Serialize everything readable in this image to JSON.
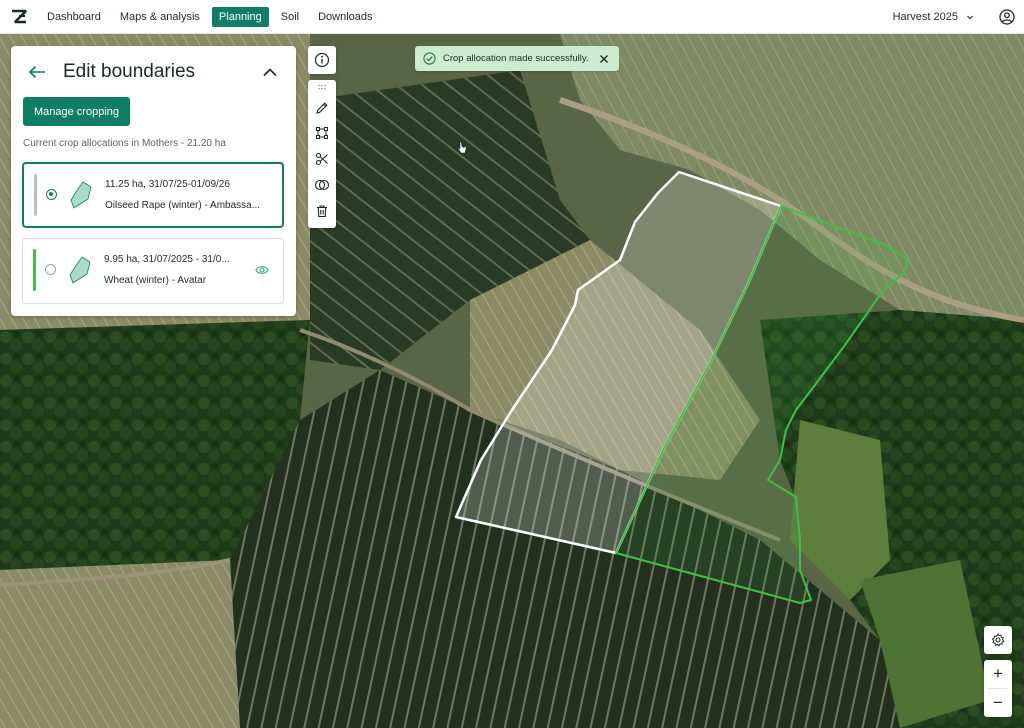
{
  "nav": {
    "items": [
      {
        "label": "Dashboard",
        "active": false
      },
      {
        "label": "Maps & analysis",
        "active": false
      },
      {
        "label": "Planning",
        "active": true
      },
      {
        "label": "Soil",
        "active": false
      },
      {
        "label": "Downloads",
        "active": false
      }
    ],
    "season": "Harvest 2025"
  },
  "panel": {
    "title": "Edit boundaries",
    "manage_button": "Manage cropping",
    "allocation_caption": "Current crop allocations in Mothers - 21.20 ha",
    "crops": [
      {
        "line1": "11.25 ha,  31/07/25-01/09/26",
        "line2": "Oilseed Rape (winter) - Ambassa...",
        "selected": true,
        "bar_color": "#b9bfbc"
      },
      {
        "line1": "9.95 ha,  31/07/2025 - 31/0...",
        "line2": "Wheat (winter) - Avatar",
        "selected": false,
        "bar_color": "#3fbf4a"
      }
    ]
  },
  "toast": {
    "message": "Crop allocation made successfully."
  },
  "map": {
    "zoom_in": "+",
    "zoom_out": "−"
  },
  "colors": {
    "accent": "#0f7e65",
    "toast_bg": "#cdeccf",
    "boundary_selected": "#ffffff",
    "boundary_other": "#3fbf4a"
  }
}
